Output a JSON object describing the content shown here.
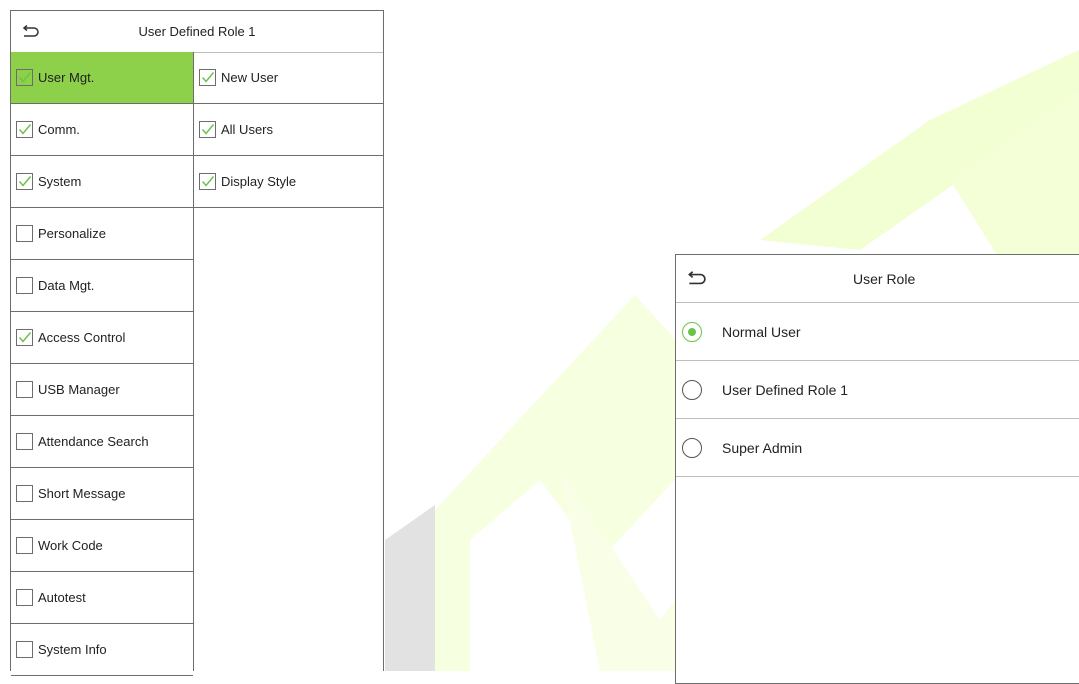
{
  "colors": {
    "accent_green": "#8dd04a",
    "radio_green": "#6cc24a",
    "border": "#6d6d6d"
  },
  "left_screen": {
    "title": "User Defined Role 1",
    "back_icon": "back-arrow-icon",
    "categories": [
      {
        "label": "User Mgt.",
        "checked": true,
        "active": true
      },
      {
        "label": "Comm.",
        "checked": true,
        "active": false
      },
      {
        "label": "System",
        "checked": true,
        "active": false
      },
      {
        "label": "Personalize",
        "checked": false,
        "active": false
      },
      {
        "label": "Data Mgt.",
        "checked": false,
        "active": false
      },
      {
        "label": "Access Control",
        "checked": true,
        "active": false
      },
      {
        "label": "USB Manager",
        "checked": false,
        "active": false
      },
      {
        "label": "Attendance Search",
        "checked": false,
        "active": false
      },
      {
        "label": "Short Message",
        "checked": false,
        "active": false
      },
      {
        "label": "Work Code",
        "checked": false,
        "active": false
      },
      {
        "label": "Autotest",
        "checked": false,
        "active": false
      },
      {
        "label": "System Info",
        "checked": false,
        "active": false
      }
    ],
    "sub_items": [
      {
        "label": "New User",
        "checked": true
      },
      {
        "label": "All Users",
        "checked": true
      },
      {
        "label": "Display Style",
        "checked": true
      }
    ]
  },
  "right_screen": {
    "title": "User Role",
    "back_icon": "back-arrow-icon",
    "options": [
      {
        "label": "Normal User",
        "selected": true
      },
      {
        "label": "User Defined Role 1",
        "selected": false
      },
      {
        "label": "Super Admin",
        "selected": false
      }
    ]
  }
}
